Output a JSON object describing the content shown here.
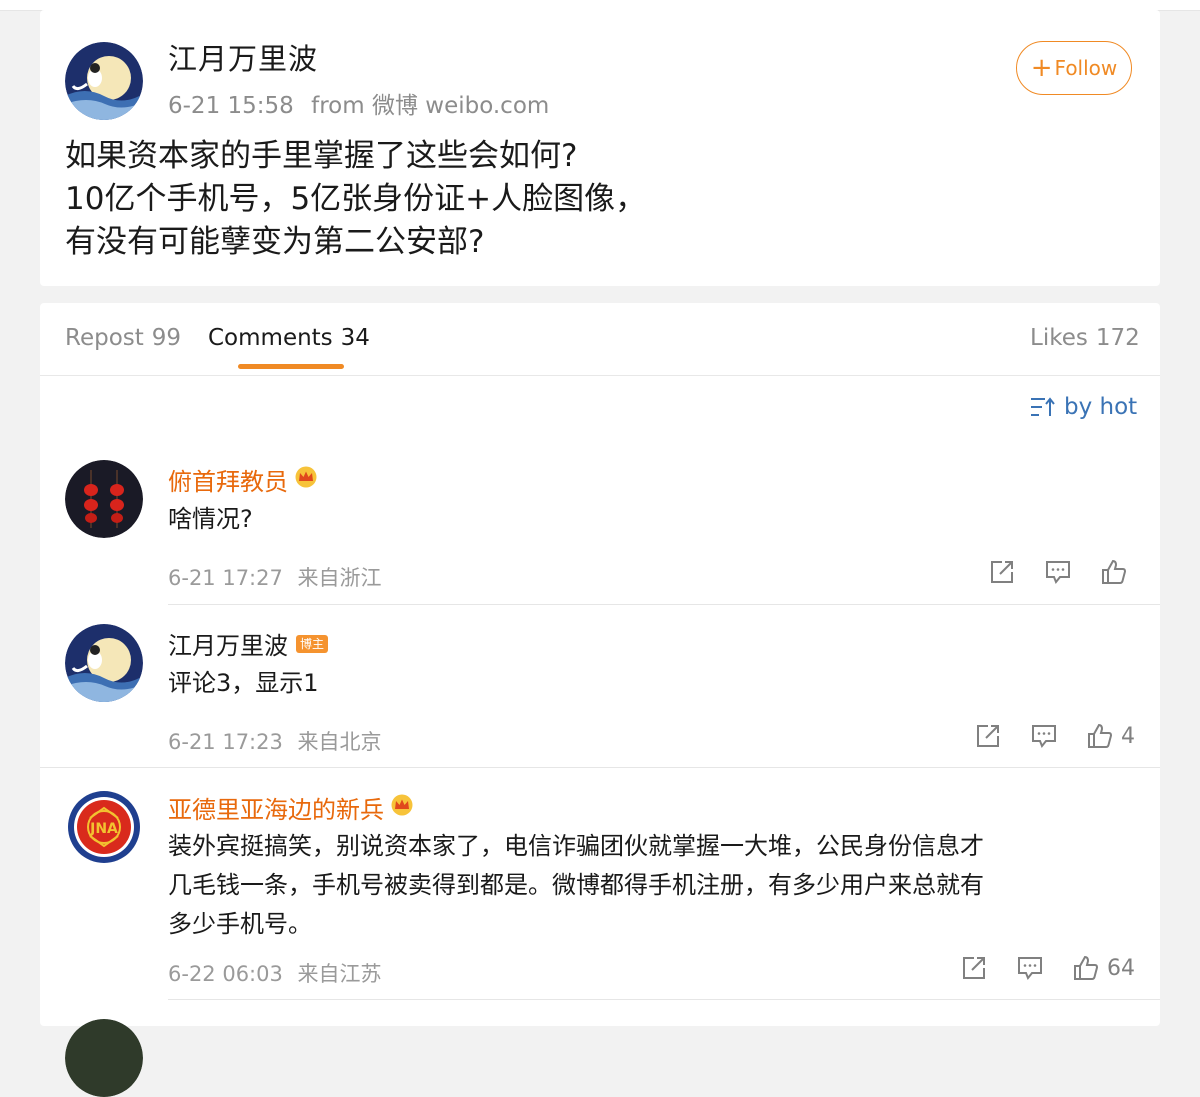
{
  "post": {
    "author": "江月万里波",
    "time": "6-21 15:58",
    "source": "from 微博 weibo.com",
    "follow_label": "Follow",
    "text_lines": [
      "如果资本家的手里掌握了这些会如何?",
      "10亿个手机号，5亿张身份证+人脸图像，",
      "有没有可能孽变为第二公安部?"
    ]
  },
  "tabs": [
    {
      "label": "Repost",
      "count": "99"
    },
    {
      "label": "Comments",
      "count": "34"
    },
    {
      "label": "Likes",
      "count": "172"
    }
  ],
  "sort_label": "by hot",
  "comments": [
    {
      "name": "俯首拜教员",
      "text_lines": [
        "啥情况?"
      ],
      "time": "6-21 17:27",
      "location": "来自浙江",
      "likes": ""
    },
    {
      "name": "江月万里波",
      "badge": "博主",
      "text_lines": [
        "评论3，显示1"
      ],
      "time": "6-21 17:23",
      "location": "来自北京",
      "likes": "4"
    },
    {
      "name": "亚德里亚海边的新兵",
      "text_lines": [
        "装外宾挺搞笑，别说资本家了，电信诈骗团伙就掌握一大堆，公民身份信息才",
        "几毛钱一条，手机号被卖得到都是。微博都得手机注册，有多少用户来总就有",
        "多少手机号。"
      ],
      "time": "6-22 06:03",
      "location": "来自江苏",
      "likes": "64"
    }
  ],
  "colors": {
    "accent_orange": "#f08a24",
    "name_orange": "#e8690c",
    "link_blue": "#3a73b5"
  }
}
